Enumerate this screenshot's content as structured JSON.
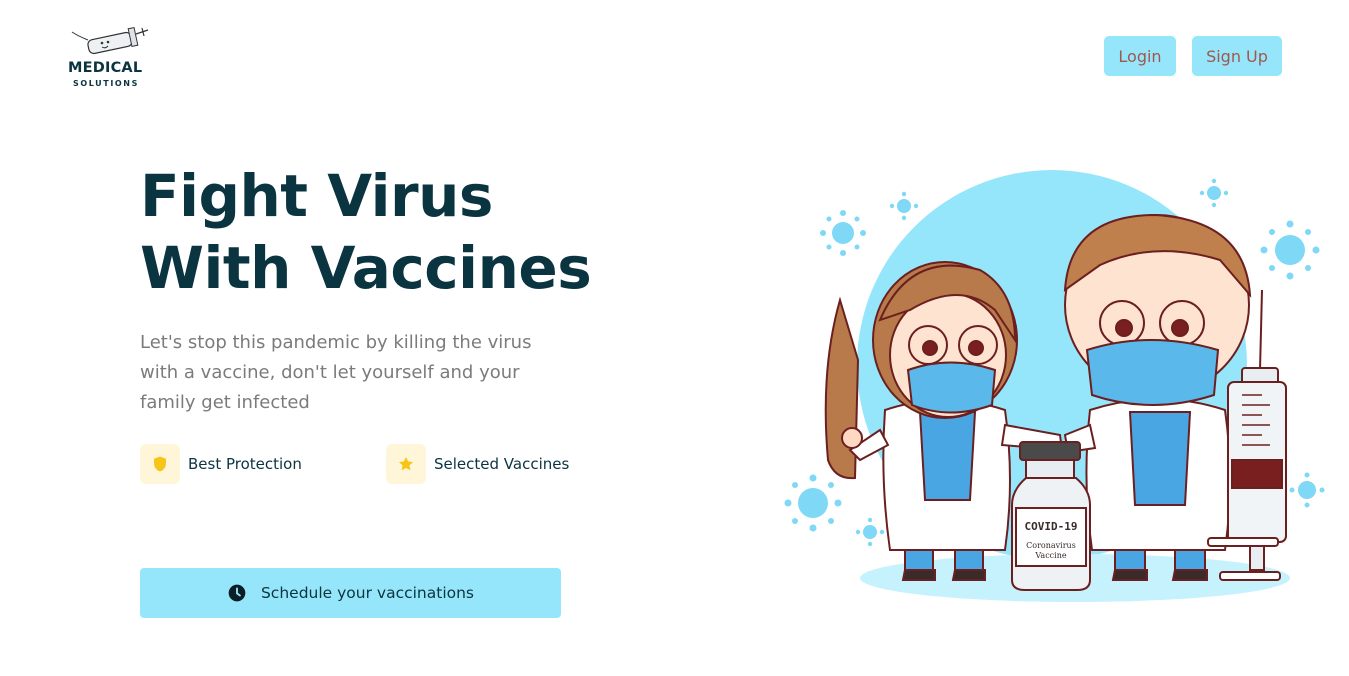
{
  "brand": {
    "name": "MEDICAL",
    "tagline": "SOLUTIONS"
  },
  "nav": {
    "login_label": "Login",
    "signup_label": "Sign Up"
  },
  "hero": {
    "title_line1": "Fight Virus",
    "title_line2": "With Vaccines",
    "description": "Let's stop this pandemic by killing the virus with a vaccine, don't let yourself and your family get infected"
  },
  "features": [
    {
      "label": "Best Protection",
      "icon": "shield-icon"
    },
    {
      "label": "Selected Vaccines",
      "icon": "star-icon"
    }
  ],
  "cta": {
    "label": "Schedule your vaccinations",
    "icon": "clock-icon"
  },
  "illustration": {
    "vial_label": "COVID-19",
    "vial_sub1": "Coronavirus",
    "vial_sub2": "Vaccine"
  },
  "colors": {
    "accent": "#96e6fb",
    "primary_text": "#0b3441",
    "muted_text": "#7b7b7b",
    "button_text": "#a0584e",
    "feature_icon_bg": "#fff6d9",
    "feature_icon": "#f5c518"
  }
}
